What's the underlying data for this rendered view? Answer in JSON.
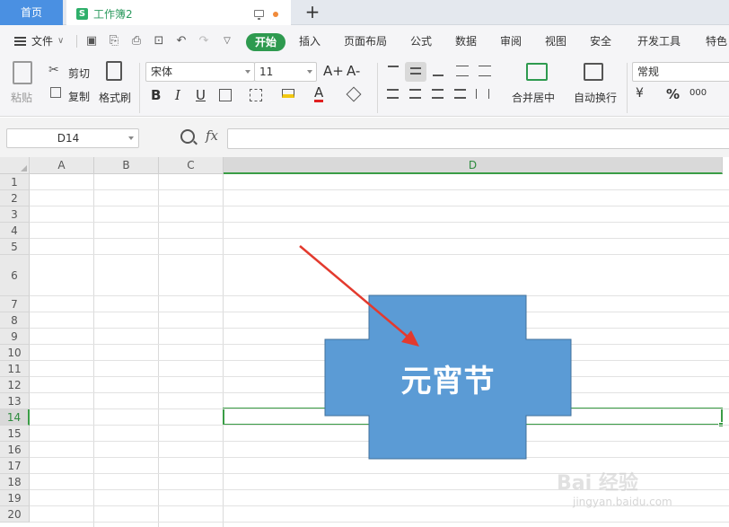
{
  "tabs": {
    "home": "首页",
    "document": "工作簿2",
    "doc_icon_letter": "S"
  },
  "menu": {
    "file": "文件",
    "start": "开始",
    "items": [
      "插入",
      "页面布局",
      "公式",
      "数据",
      "审阅",
      "视图",
      "安全",
      "开发工具",
      "特色"
    ]
  },
  "ribbon": {
    "paste": "粘贴",
    "cut": "剪切",
    "copy": "复制",
    "format_painter": "格式刷",
    "font_name": "宋体",
    "font_size": "11",
    "grow_font": "A+",
    "shrink_font": "A-",
    "bold": "B",
    "italic": "I",
    "underline": "U",
    "merge_center": "合并居中",
    "wrap_text": "自动换行",
    "number_format": "常规",
    "percent": "%",
    "thousands": "000"
  },
  "formula": {
    "cell_ref": "D14",
    "fx": "fx",
    "value": ""
  },
  "grid": {
    "columns": [
      "A",
      "B",
      "C",
      "D"
    ],
    "rows": [
      "1",
      "2",
      "3",
      "4",
      "5",
      "6",
      "7",
      "8",
      "9",
      "10",
      "11",
      "12",
      "13",
      "14",
      "15",
      "16",
      "17",
      "18",
      "19",
      "20"
    ],
    "active_column": "D",
    "active_row": "14"
  },
  "shape": {
    "text": "元宵节",
    "fill_color": "#5b9bd5",
    "border_color": "#41719c"
  },
  "annotation": {
    "arrow_color": "#e33a2e"
  },
  "watermark": {
    "main": "Bai 经验",
    "url": "jingyan.baidu.com"
  }
}
